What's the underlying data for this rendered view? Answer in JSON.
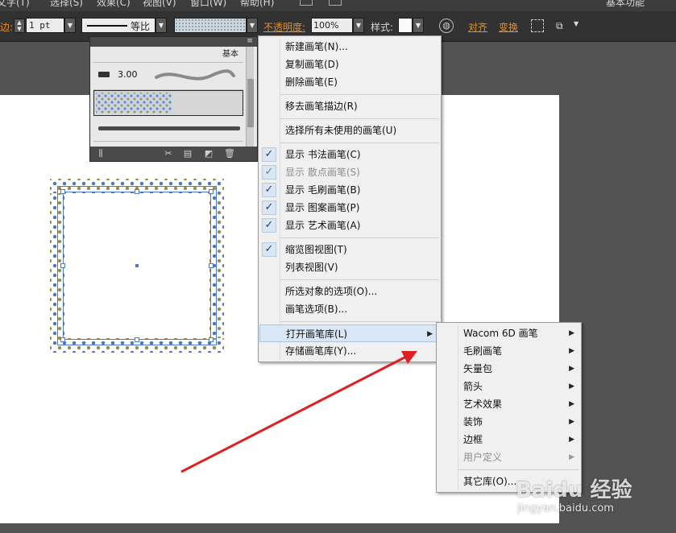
{
  "menubar": {
    "items": [
      "文字(T)",
      "选择(S)",
      "效果(C)",
      "视图(V)",
      "窗口(W)",
      "帮助(H)"
    ],
    "right_label": "基本功能"
  },
  "control_bar": {
    "stroke_label": "边:",
    "stroke_value": "1 pt",
    "stroke_style_label": "等比",
    "opacity_label": "不透明度:",
    "opacity_value": "100%",
    "style_label": "样式:",
    "align_label": "对齐",
    "transform_label": "变换",
    "accent_color": "#e38e2b"
  },
  "brush_panel": {
    "group_label": "基本",
    "brush_size_label": "3.00",
    "footer_icons": [
      "brush-libraries-menu-icon",
      "remove-stroke-icon",
      "brush-options-icon",
      "new-brush-icon",
      "delete-brush-icon"
    ]
  },
  "context_menu": {
    "items": [
      {
        "label": "新建画笔(N)...",
        "checked": false,
        "disabled": false
      },
      {
        "label": "复制画笔(D)",
        "checked": false,
        "disabled": false
      },
      {
        "label": "删除画笔(E)",
        "checked": false,
        "disabled": false
      },
      {
        "label": "移去画笔描边(R)",
        "checked": false,
        "disabled": false
      },
      {
        "label": "选择所有未使用的画笔(U)",
        "checked": false,
        "disabled": false
      },
      {
        "label": "显示 书法画笔(C)",
        "checked": true,
        "disabled": false
      },
      {
        "label": "显示 散点画笔(S)",
        "checked": true,
        "disabled": true
      },
      {
        "label": "显示 毛刷画笔(B)",
        "checked": true,
        "disabled": false
      },
      {
        "label": "显示 图案画笔(P)",
        "checked": true,
        "disabled": false
      },
      {
        "label": "显示 艺术画笔(A)",
        "checked": true,
        "disabled": false
      },
      {
        "label": "缩览图视图(T)",
        "checked": true,
        "disabled": false
      },
      {
        "label": "列表视图(V)",
        "checked": false,
        "disabled": false
      },
      {
        "label": "所选对象的选项(O)...",
        "checked": false,
        "disabled": false
      },
      {
        "label": "画笔选项(B)...",
        "checked": false,
        "disabled": false
      },
      {
        "label": "打开画笔库(L)",
        "checked": false,
        "disabled": false,
        "submenu": true,
        "highlighted": true
      },
      {
        "label": "存储画笔库(Y)...",
        "checked": false,
        "disabled": false
      }
    ]
  },
  "submenu": {
    "items": [
      {
        "label": "Wacom 6D 画笔",
        "submenu": true,
        "disabled": false
      },
      {
        "label": "毛刷画笔",
        "submenu": true,
        "disabled": false
      },
      {
        "label": "矢量包",
        "submenu": true,
        "disabled": false
      },
      {
        "label": "箭头",
        "submenu": true,
        "disabled": false
      },
      {
        "label": "艺术效果",
        "submenu": true,
        "disabled": false
      },
      {
        "label": "装饰",
        "submenu": true,
        "disabled": false
      },
      {
        "label": "边框",
        "submenu": true,
        "disabled": false
      },
      {
        "label": "用户定义",
        "submenu": true,
        "disabled": true
      },
      {
        "label": "其它库(O)...",
        "submenu": false,
        "disabled": false
      }
    ]
  },
  "annotation": {
    "arrow_color": "#e02020"
  },
  "artwork": {
    "dot_color_blue": "#4a78b8",
    "dot_color_olive": "#8f8f56",
    "selection_color": "#4a7bd0"
  },
  "watermark": {
    "text": "Baidu 经验",
    "url": "jingyan.baidu.com"
  }
}
